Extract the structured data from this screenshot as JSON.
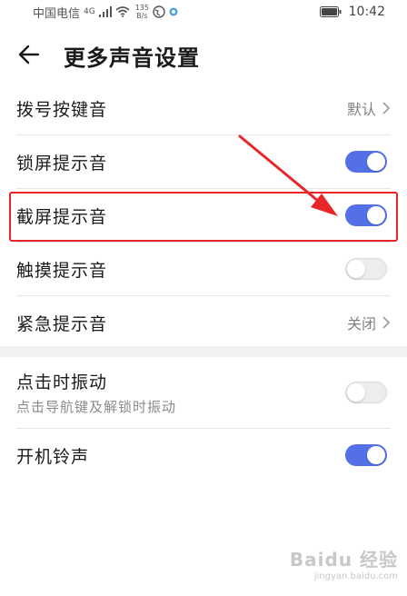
{
  "status_bar": {
    "carrier": "中国电信",
    "net_type": "4G",
    "speed_value": "135",
    "speed_unit": "B/s",
    "time": "10:42"
  },
  "header": {
    "back_icon": "arrow-left-icon",
    "title": "更多声音设置"
  },
  "settings": {
    "dial_keypad": {
      "label": "拨号按键音",
      "value": "默认"
    },
    "lock_screen": {
      "label": "锁屏提示音",
      "enabled": true
    },
    "screenshot": {
      "label": "截屏提示音",
      "enabled": true
    },
    "touch": {
      "label": "触摸提示音",
      "enabled": false
    },
    "emergency": {
      "label": "紧急提示音",
      "value": "关闭"
    }
  },
  "settings2": {
    "tap_vibration": {
      "label": "点击时振动",
      "sublabel": "点击导航键及解锁时振动",
      "enabled": false
    },
    "boot_sound": {
      "label": "开机铃声",
      "enabled": true
    }
  },
  "annotation": {
    "highlight_color": "#e8262a"
  },
  "colors": {
    "accent": "#5470e7"
  },
  "watermark": {
    "text": "Baidu 经验",
    "url": "jingyan.baidu.com"
  }
}
